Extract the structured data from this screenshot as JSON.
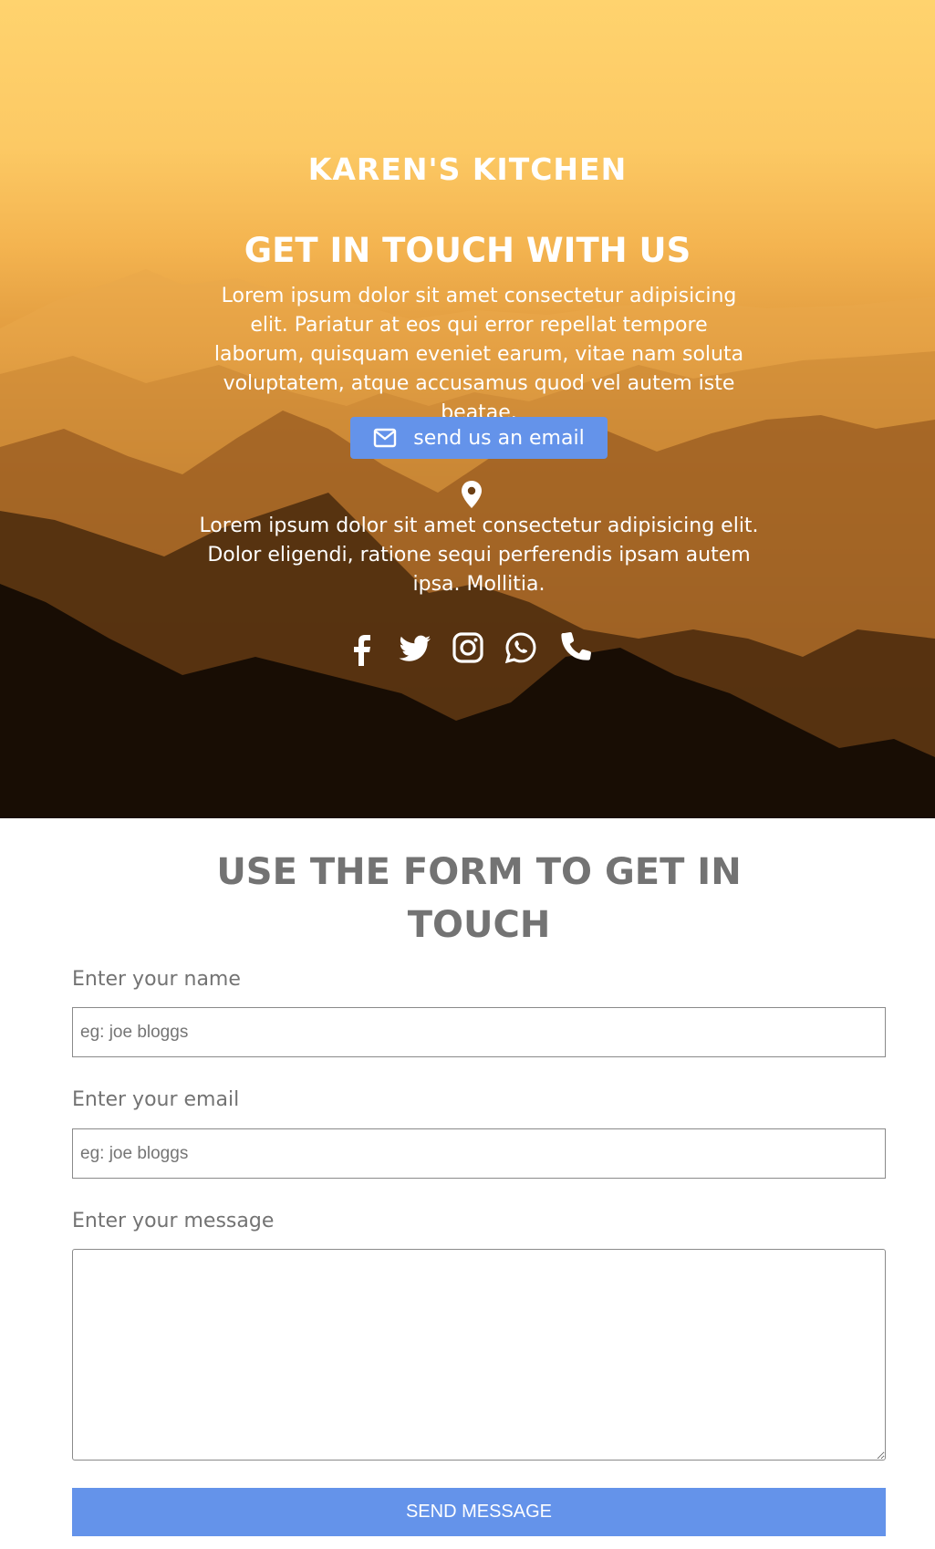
{
  "brand": {
    "name": "KAREN'S KITCHEN"
  },
  "hero": {
    "title": "GET IN TOUCH WITH US",
    "text": "Lorem ipsum dolor sit amet consectetur adipisicing elit. Pariatur at eos qui error repellat tempore laborum, quisquam eveniet earum, vitae nam soluta voluptatem, atque accusamus quod vel autem iste beatae.",
    "email_button": {
      "icon": "envelope-icon",
      "label": "send us an email"
    },
    "location_icon": "map-marker-icon",
    "address_text": "Lorem ipsum dolor sit amet consectetur adipisicing elit. Dolor eligendi, ratione sequi perferendis ipsam autem ipsa. Mollitia."
  },
  "socials": [
    {
      "name": "facebook",
      "icon": "facebook-icon"
    },
    {
      "name": "twitter",
      "icon": "twitter-icon"
    },
    {
      "name": "instagram",
      "icon": "instagram-icon"
    },
    {
      "name": "whatsapp",
      "icon": "whatsapp-icon"
    },
    {
      "name": "phone",
      "icon": "phone-icon"
    }
  ],
  "form": {
    "title": "USE THE FORM TO GET IN TOUCH",
    "name_label": "Enter your name",
    "name_placeholder": "eg: joe bloggs",
    "name_value": "",
    "email_label": "Enter your email",
    "email_placeholder": "eg: joe bloggs",
    "email_value": "",
    "message_label": "Enter your message",
    "message_value": "",
    "submit_label": "SEND MESSAGE"
  },
  "colors": {
    "accent": "#6493ea",
    "label_gray": "#737373",
    "hero_top": "#ffd36e",
    "hero_bottom": "#050302"
  }
}
